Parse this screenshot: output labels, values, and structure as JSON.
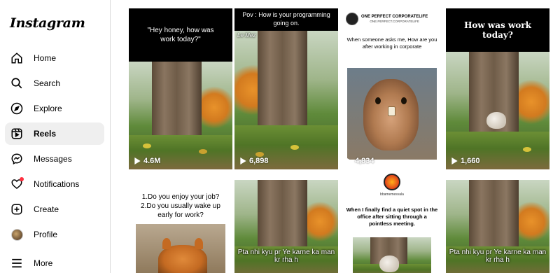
{
  "app": {
    "logo": "Instagram"
  },
  "sidebar": {
    "items": [
      {
        "label": "Home",
        "icon": "home-icon"
      },
      {
        "label": "Search",
        "icon": "search-icon"
      },
      {
        "label": "Explore",
        "icon": "compass-icon"
      },
      {
        "label": "Reels",
        "icon": "reels-icon",
        "active": true
      },
      {
        "label": "Messages",
        "icon": "messenger-icon"
      },
      {
        "label": "Notifications",
        "icon": "heart-icon",
        "badge": true
      },
      {
        "label": "Create",
        "icon": "plus-square-icon"
      },
      {
        "label": "Profile",
        "icon": "avatar"
      },
      {
        "label": "More",
        "icon": "menu-icon"
      }
    ]
  },
  "grid": {
    "tiles": [
      {
        "caption": "\"Hey honey, how was work today?\"",
        "views": "4.6M"
      },
      {
        "caption": "Pov : How is your programming going on.",
        "watermark": "Le Mez",
        "views": "6,898"
      },
      {
        "brand_name": "ONE PERFECT CORPORATELIFE",
        "brand_sub": "ONE.PERFECT.CORPORATELIFE",
        "caption": "When someone asks me, How are you after working in corporate",
        "views": "4,834"
      },
      {
        "caption": "How was work today?",
        "views": "1,660"
      },
      {
        "caption": "1.Do you enjoy your job?\n2.Do you usually wake up early for work?"
      },
      {
        "overlay": "Pta nhi kyu pr Ye karne ka man kr rha h"
      },
      {
        "handle": "bbamemesvala",
        "caption": "When I finally find a quiet spot in the office after sitting through a pointless meeting."
      },
      {
        "overlay": "Pta nhi kyu pr Ye karne ka man kr rha h"
      }
    ]
  },
  "colors": {
    "active_bg": "#efefef",
    "notification_dot": "#ff3040",
    "border": "#dbdbdb"
  }
}
